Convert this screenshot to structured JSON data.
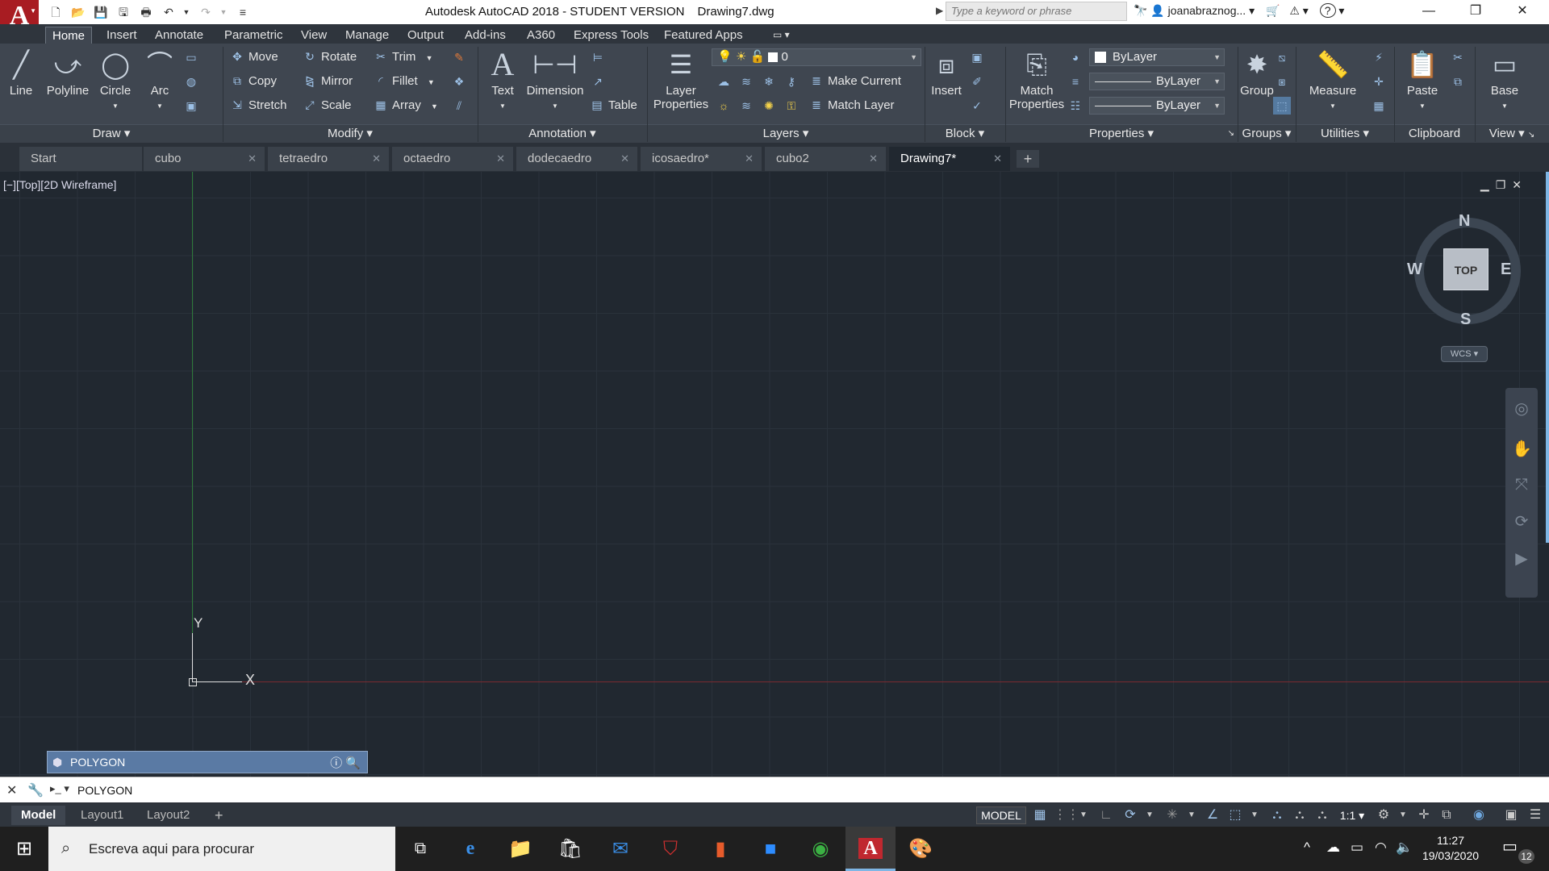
{
  "titlebar": {
    "logo_letter": "A",
    "title": "Autodesk AutoCAD 2018 - STUDENT VERSION",
    "filename": "Drawing7.dwg",
    "search_placeholder": "Type a keyword or phrase",
    "username": "joanabraznog...",
    "help_label": "?"
  },
  "ribbon_tabs": [
    "Home",
    "Insert",
    "Annotate",
    "Parametric",
    "View",
    "Manage",
    "Output",
    "Add-ins",
    "A360",
    "Express Tools",
    "Featured Apps"
  ],
  "ribbon": {
    "draw": {
      "title": "Draw",
      "line": "Line",
      "polyline": "Polyline",
      "circle": "Circle",
      "arc": "Arc"
    },
    "modify": {
      "title": "Modify",
      "move": "Move",
      "rotate": "Rotate",
      "trim": "Trim",
      "copy": "Copy",
      "mirror": "Mirror",
      "fillet": "Fillet",
      "stretch": "Stretch",
      "scale": "Scale",
      "array": "Array"
    },
    "annotation": {
      "title": "Annotation",
      "text": "Text",
      "dimension": "Dimension",
      "table": "Table"
    },
    "layers": {
      "title": "Layers",
      "layer_properties_1": "Layer",
      "layer_properties_2": "Properties",
      "layer_value": "0",
      "make_current": "Make Current",
      "match_layer": "Match Layer"
    },
    "block": {
      "title": "Block",
      "insert": "Insert"
    },
    "properties": {
      "title": "Properties",
      "match_1": "Match",
      "match_2": "Properties",
      "color": "ByLayer",
      "linetype": "ByLayer",
      "lineweight": "ByLayer"
    },
    "groups": {
      "title": "Groups",
      "group": "Group"
    },
    "utilities": {
      "title": "Utilities",
      "measure": "Measure"
    },
    "clipboard": {
      "title": "Clipboard",
      "paste": "Paste"
    },
    "view": {
      "title": "View",
      "base": "Base"
    }
  },
  "file_tabs": [
    {
      "label": "Start",
      "closable": false
    },
    {
      "label": "cubo",
      "closable": true
    },
    {
      "label": "tetraedro",
      "closable": true
    },
    {
      "label": "octaedro",
      "closable": true
    },
    {
      "label": "dodecaedro",
      "closable": true
    },
    {
      "label": "icosaedro*",
      "closable": true
    },
    {
      "label": "cubo2",
      "closable": true
    },
    {
      "label": "Drawing7*",
      "closable": true,
      "active": true
    }
  ],
  "viewport": {
    "label": "[−][Top][2D Wireframe]",
    "viewcube": {
      "top": "TOP",
      "n": "N",
      "s": "S",
      "e": "E",
      "w": "W",
      "wcs": "WCS"
    },
    "ucs": {
      "x": "X",
      "y": "Y"
    }
  },
  "command": {
    "popup": "POLYGON",
    "input": "POLYGON"
  },
  "status": {
    "layout_tabs": [
      "Model",
      "Layout1",
      "Layout2"
    ],
    "model": "MODEL",
    "scale": "1:1"
  },
  "taskbar": {
    "search_placeholder": "Escreva aqui para procurar",
    "time": "11:27",
    "date": "19/03/2020",
    "notifications": "12"
  }
}
